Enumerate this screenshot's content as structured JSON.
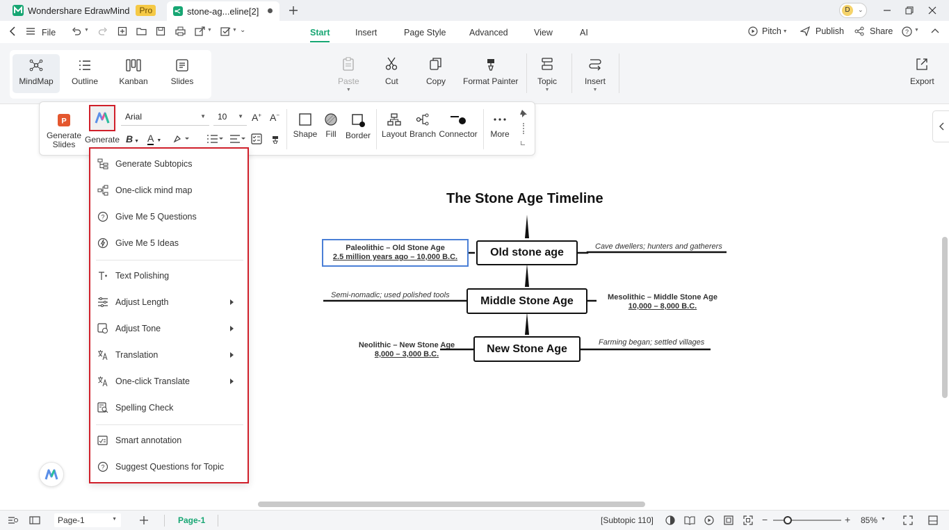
{
  "titlebar": {
    "app_tab": "Wondershare EdrawMind",
    "pro_badge": "Pro",
    "doc_tab": "stone-ag...eline[2]",
    "avatar_letter": "D"
  },
  "menubar": {
    "file": "File",
    "tabs": [
      "Start",
      "Insert",
      "Page Style",
      "Advanced",
      "View",
      "AI"
    ],
    "active_tab": "Start",
    "pitch": "Pitch",
    "publish": "Publish",
    "share": "Share"
  },
  "ribbon": {
    "views": [
      "MindMap",
      "Outline",
      "Kanban",
      "Slides"
    ],
    "paste": "Paste",
    "cut": "Cut",
    "copy": "Copy",
    "format_painter": "Format Painter",
    "topic": "Topic",
    "insert": "Insert",
    "export": "Export"
  },
  "floatbar": {
    "generate_slides": "Generate Slides",
    "generate": "Generate",
    "font": "Arial",
    "font_size": "10",
    "shape": "Shape",
    "fill": "Fill",
    "border": "Border",
    "layout": "Layout",
    "branch": "Branch",
    "connector": "Connector",
    "more": "More"
  },
  "ai_menu": {
    "items": [
      {
        "label": "Generate Subtopics",
        "icon": "subtopics-icon"
      },
      {
        "label": "One-click mind map",
        "icon": "mindmap-icon"
      },
      {
        "label": "Give Me 5 Questions",
        "icon": "question-icon"
      },
      {
        "label": "Give Me 5 Ideas",
        "icon": "bulb-icon"
      },
      {
        "label": "Text Polishing",
        "icon": "text-polish-icon"
      },
      {
        "label": "Adjust Length",
        "icon": "adjust-length-icon"
      },
      {
        "label": "Adjust Tone",
        "icon": "adjust-tone-icon"
      },
      {
        "label": "Translation",
        "icon": "translate-icon"
      },
      {
        "label": "One-click Translate",
        "icon": "translate-icon"
      },
      {
        "label": "Spelling Check",
        "icon": "spell-check-icon"
      },
      {
        "label": "Smart annotation",
        "icon": "annotation-icon"
      },
      {
        "label": "Suggest Questions for Topic",
        "icon": "question-icon"
      }
    ]
  },
  "mindmap": {
    "title": "The Stone Age Timeline",
    "topics": [
      "Old stone age",
      "Middle Stone Age",
      "New Stone Age"
    ],
    "paleolithic": {
      "name": "Paleolithic – Old Stone Age",
      "dates": "2.5 million years ago – 10,000 B.C."
    },
    "mesolithic": {
      "name": "Mesolithic – Middle Stone Age",
      "dates": "10,000 – 8,000 B.C."
    },
    "neolithic": {
      "name": "Neolithic – New Stone Age",
      "dates": "8,000 – 3,000 B.C."
    },
    "notes": {
      "old": "Cave dwellers; hunters and gatherers",
      "middle": "Semi-nomadic; used polished tools",
      "new": "Farming began; settled villages"
    }
  },
  "statusbar": {
    "page_select": "Page-1",
    "page_tab": "Page-1",
    "selection": "[Subtopic 110]",
    "zoom": "85%"
  },
  "colors": {
    "accent": "#17a673",
    "highlight_red": "#d01f2a",
    "selected_blue": "#4a7fd6"
  }
}
